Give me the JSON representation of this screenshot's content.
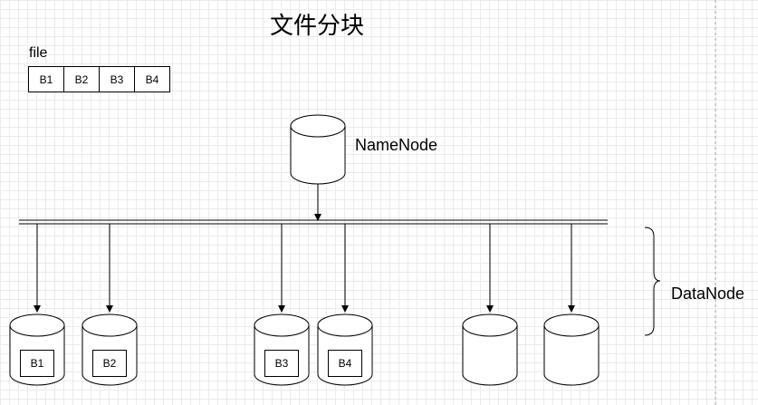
{
  "title": "文件分块",
  "file": {
    "label": "file",
    "blocks": [
      "B1",
      "B2",
      "B3",
      "B4"
    ]
  },
  "namenode": {
    "label": "NameNode"
  },
  "datanode": {
    "label": "DataNode",
    "nodes": [
      "B1",
      "B2",
      "B3",
      "B4",
      "",
      ""
    ]
  }
}
